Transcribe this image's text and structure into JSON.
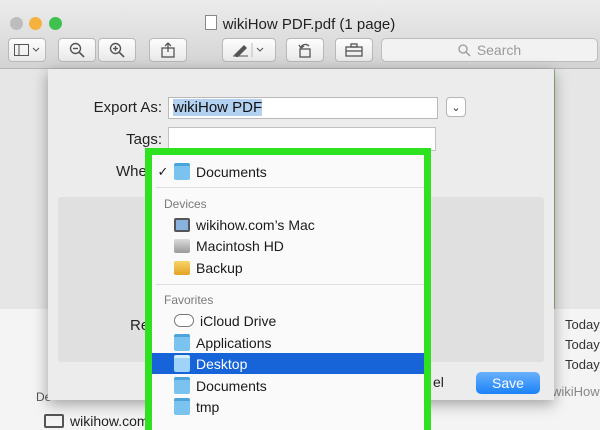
{
  "window": {
    "title": "wikiHow PDF.pdf (1 page)"
  },
  "toolbar": {
    "sidebar_icon": "sidebar-icon",
    "zoom_out_icon": "zoom-out-icon",
    "zoom_in_icon": "zoom-in-icon",
    "share_icon": "share-icon",
    "markup_icon": "pen-icon",
    "rotate_icon": "rotate-icon",
    "toolbox_icon": "toolbox-icon",
    "search_placeholder": "Search"
  },
  "sheet": {
    "export_label": "Export As:",
    "export_value": "wikiHow PDF",
    "tags_label": "Tags:",
    "where_label": "Whe",
    "re_label": "Re",
    "cancel_label": "el",
    "save_label": "Save"
  },
  "popup": {
    "current": "Documents",
    "devices_header": "Devices",
    "devices": [
      "wikihow.com’s Mac",
      "Macintosh HD",
      "Backup"
    ],
    "favorites_header": "Favorites",
    "favorites": [
      "iCloud Drive",
      "Applications",
      "Desktop",
      "Documents",
      "tmp"
    ],
    "selected": "Desktop"
  },
  "background": {
    "today_labels": [
      "Today",
      "Today",
      "Today"
    ],
    "devices_label": "De",
    "mac_label": "wikihow.com",
    "watermark": "wikiHow"
  },
  "colors": {
    "highlight": "#2ee21f",
    "selection": "#1763d8",
    "save": "#1a82f8"
  }
}
